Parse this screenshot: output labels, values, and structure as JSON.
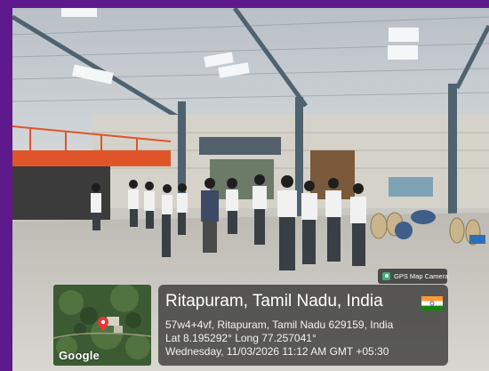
{
  "badge": {
    "label": "GPS Map Camera",
    "icon": "gps-map-camera-icon"
  },
  "location": {
    "title": "Ritapuram, Tamil Nadu, India",
    "address": "57w4+4vf, Ritapuram, Tamil Nadu 629159, India",
    "coords": "Lat 8.195292° Long 77.257041°",
    "datetime": "Wednesday, 11/03/2026 11:12 AM GMT +05:30",
    "flag_icon": "india-flag-icon"
  },
  "map": {
    "provider": "Google",
    "pin_icon": "map-pin-icon"
  },
  "colors": {
    "border": "#5e1a8c",
    "card_bg": "#282828",
    "pin": "#e53935"
  }
}
